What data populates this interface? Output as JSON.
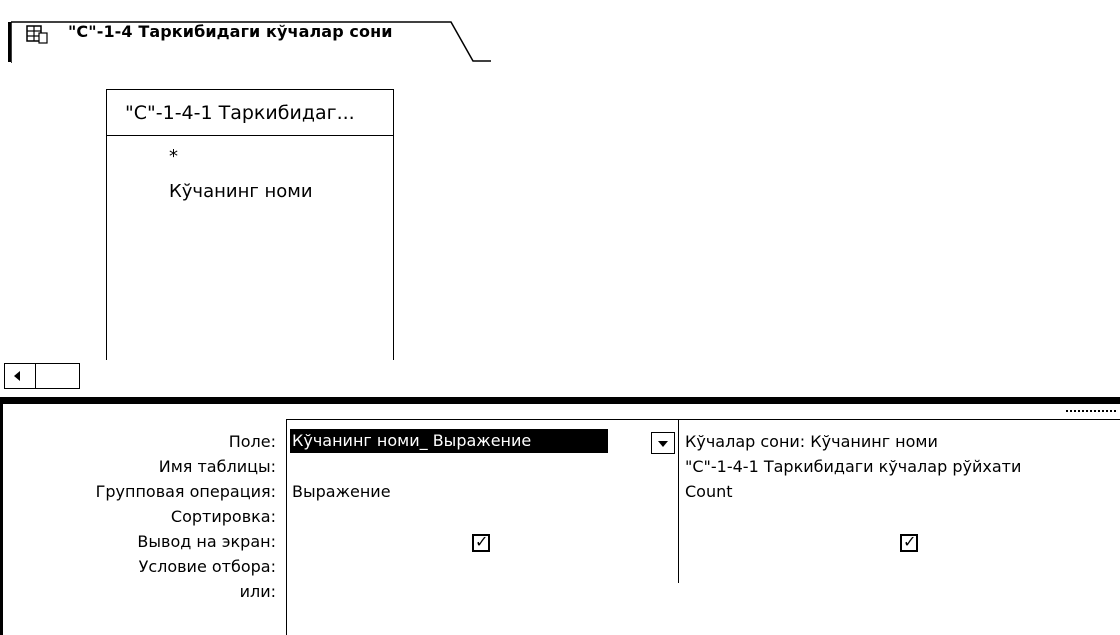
{
  "tab": {
    "title": "\"С\"-1-4 Таркибидаги кўчалар сони",
    "icon": "query-design-icon"
  },
  "table": {
    "title": "\"С\"-1-4-1  Таркибидаг...",
    "fields": [
      "*",
      "Кўчанинг номи"
    ]
  },
  "grid": {
    "row_labels": {
      "field": "Поле:",
      "table": "Имя таблицы:",
      "total": "Групповая операция:",
      "sort": "Сортировка:",
      "show": "Вывод на экран:",
      "criteria": "Условие отбора:",
      "or": "или:"
    },
    "columns": [
      {
        "field": "Кўчанинг номи_ Выражение",
        "table": "",
        "total": "Выражение",
        "sort": "",
        "show": true
      },
      {
        "field": "Кўчалар сони: Кўчанинг номи",
        "table": "\"С\"-1-4-1  Таркибидаги кўчалар рўйхати",
        "total": "Count",
        "sort": "",
        "show": true
      }
    ]
  }
}
